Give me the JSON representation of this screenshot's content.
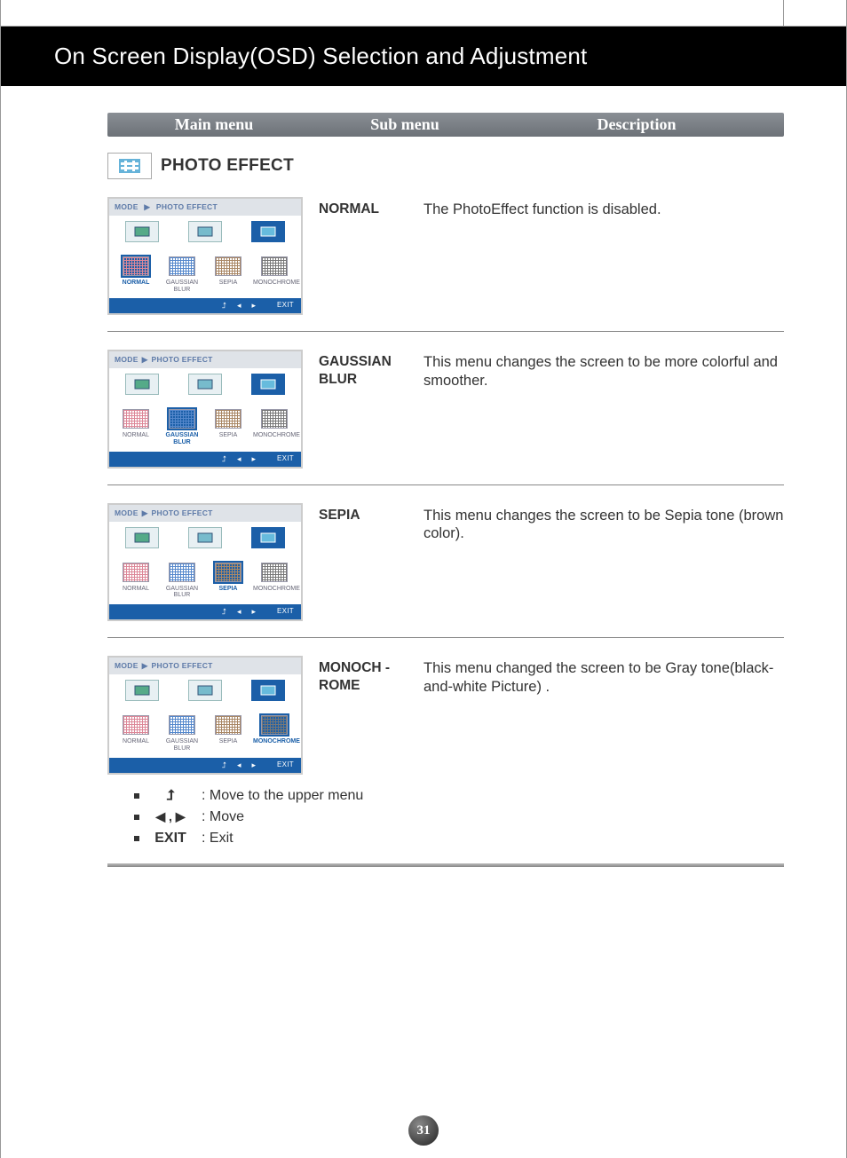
{
  "header": {
    "title": "On Screen Display(OSD) Selection and Adjustment"
  },
  "columns": {
    "main": "Main menu",
    "sub": "Sub menu",
    "desc": "Description"
  },
  "mainmenu": {
    "title": "PHOTO EFFECT"
  },
  "osd": {
    "crumb_mode": "MODE",
    "crumb_target": "PHOTO EFFECT",
    "opts": {
      "normal": "NORMAL",
      "gauss": "GAUSSIAN BLUR",
      "sepia": "SEPIA",
      "mono": "MONOCHROME"
    },
    "exit": "EXIT"
  },
  "rows": {
    "normal": {
      "sub": "NORMAL",
      "desc": "The PhotoEffect function is disabled."
    },
    "gauss": {
      "sub": "GAUSSIAN BLUR",
      "desc": "This menu changes the screen to be more colorful and smoother."
    },
    "sepia": {
      "sub": "SEPIA",
      "desc": "This menu changes the screen to be Sepia tone (brown color)."
    },
    "mono": {
      "sub": "MONOCH -ROME",
      "desc": "This menu changed the screen to be Gray tone(black-and-white Picture) ."
    }
  },
  "legend": {
    "up": ": Move to the upper menu",
    "move": ": Move",
    "exit_label": "EXIT",
    "exit": ": Exit",
    "comma": ","
  },
  "page": "31"
}
